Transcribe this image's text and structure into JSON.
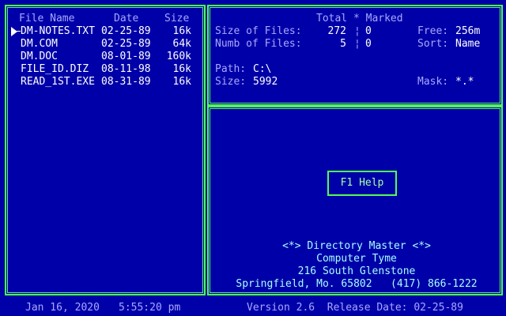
{
  "file_list": {
    "headers": {
      "name": "File Name",
      "date": "Date",
      "size": "Size"
    },
    "files": [
      {
        "name": "DM-NOTES.TXT",
        "date": "02-25-89",
        "size": "16k",
        "selected": true
      },
      {
        "name": "DM.COM",
        "date": "02-25-89",
        "size": "64k"
      },
      {
        "name": "DM.DOC",
        "date": "08-01-89",
        "size": "160k"
      },
      {
        "name": "FILE_ID.DIZ",
        "date": "08-11-98",
        "size": "16k"
      },
      {
        "name": "READ_1ST.EXE",
        "date": "08-31-89",
        "size": "16k"
      }
    ]
  },
  "info": {
    "header": "Total * Marked",
    "size_of_files_label": "Size of Files:",
    "size_of_files_total": "272",
    "size_of_files_marked": "0",
    "numb_of_files_label": "Numb of Files:",
    "numb_of_files_total": "5",
    "numb_of_files_marked": "0",
    "sep": "¦",
    "free_label": "Free:",
    "free_value": "256m",
    "sort_label": "Sort:",
    "sort_value": "Name",
    "path_label": "Path:",
    "path_value": "C:\\",
    "size_label": "Size:",
    "size_value": "5992",
    "mask_label": "Mask:",
    "mask_value": "*.*"
  },
  "help": {
    "button_label": "F1  Help",
    "title": "<*> Directory Master <*>",
    "company": "Computer Tyme",
    "address": "216 South Glenstone",
    "city_phone": "Springfield, Mo. 65802   (417) 866-1222"
  },
  "status": {
    "date": "Jan 16, 2020",
    "time": "5:55:20 pm",
    "version": "Version 2.6  Release Date: 02-25-89"
  }
}
